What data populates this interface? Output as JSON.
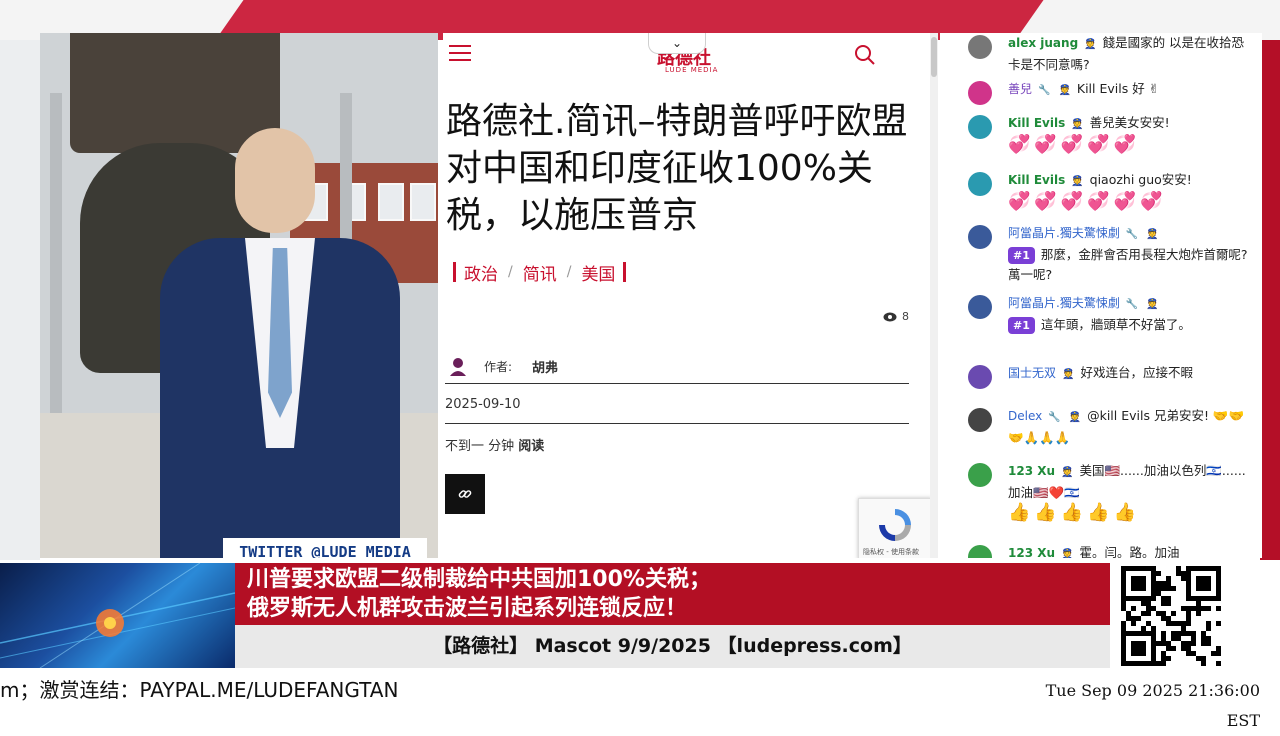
{
  "video": {
    "twitter_handle": "TWITTER  @LUDE_MEDIA"
  },
  "article": {
    "logo_text": "路德社",
    "logo_sub": "LUDE MEDIA",
    "title": "路德社.简讯–特朗普呼吁欧盟对中国和印度征收100%关税，以施压普京",
    "categories": [
      "政治",
      "简讯",
      "美国"
    ],
    "category_sep": "/",
    "views": "8",
    "author_label": "作者:",
    "author_name": "胡弗",
    "date": "2025-09-10",
    "read_time_prefix": "不到一 分钟",
    "read_time_suffix": "阅读",
    "recaptcha_text": "隐私权 - 使用条款"
  },
  "chat": {
    "messages": [
      {
        "user": "alex juang",
        "text": "餞是國家的 以是在收拾恐 卡是不同意嗎?"
      },
      {
        "user": "善兒",
        "text": "Kill Evils 好 ✌"
      },
      {
        "user": "Kill Evils",
        "text": "善兒美女安安!"
      },
      {
        "user": "Kill Evils",
        "text": "qiaozhi guo安安!"
      },
      {
        "user": "阿當晶片.獨夫驚悚劇",
        "rank": "#1",
        "text": "那麼，金胖會否用長程大炮炸首爾呢? 萬一呢?"
      },
      {
        "user": "阿當晶片.獨夫驚悚劇",
        "rank": "#1",
        "text": "這年頭，牆頭草不好當了。"
      },
      {
        "user": "国士无双",
        "text": "好戏连台，应接不暇"
      },
      {
        "user": "Delex",
        "text": "@kill Evils 兄弟安安! 🤝🤝🤝🙏🙏🙏"
      },
      {
        "user": "123 Xu",
        "text": "美国🇺🇸......加油以色列🇮🇱......加油🇺🇸❤️🇮🇱"
      },
      {
        "user": "123 Xu",
        "text": "霍。闫。路。加油"
      }
    ],
    "emoji_heart_row": "💞💞💞💞💞",
    "emoji_heart_row2": "💞💞💞💞💞💞",
    "emoji_thumbs_row": "👍👍👍👍👍"
  },
  "lower_third": {
    "headline_line1": "川普要求欧盟二级制裁给中共国加100%关税；",
    "headline_line2": "俄罗斯无人机群攻击波兰引起系列连锁反应！",
    "subline": "【路德社】 Mascot 9/9/2025 【ludepress.com】"
  },
  "ticker": {
    "text": "m；激赏连结：PAYPAL.ME/LUDEFANGTAN"
  },
  "clock": {
    "text": "Tue Sep 09 2025 21:36:00 EST"
  },
  "colors": {
    "accent": "#c8102e",
    "headline_bg": "#b30f24",
    "rank_badge": "#7a3fd6"
  }
}
